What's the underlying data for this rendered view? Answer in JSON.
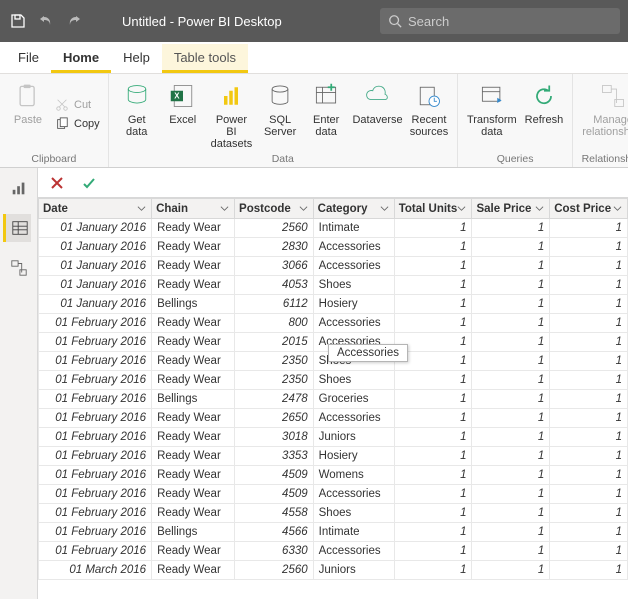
{
  "titlebar": {
    "title": "Untitled - Power BI Desktop",
    "search_placeholder": "Search"
  },
  "menutabs": {
    "file": "File",
    "home": "Home",
    "help": "Help",
    "table_tools": "Table tools"
  },
  "ribbon": {
    "group_clipboard": "Clipboard",
    "group_data": "Data",
    "group_queries": "Queries",
    "group_relationships": "Relationships",
    "paste": "Paste",
    "cut": "Cut",
    "copy": "Copy",
    "get_data": "Get\ndata",
    "excel": "Excel",
    "pbi_datasets": "Power BI\ndatasets",
    "sql_server": "SQL\nServer",
    "enter_data": "Enter\ndata",
    "dataverse": "Dataverse",
    "recent_sources": "Recent\nsources",
    "transform_data": "Transform\ndata",
    "refresh": "Refresh",
    "manage_rel": "Manage\nrelationships"
  },
  "columns": [
    "Date",
    "Chain",
    "Postcode",
    "Category",
    "Total Units",
    "Sale Price",
    "Cost Price"
  ],
  "tooltip": "Accessories",
  "rows": [
    {
      "date": "01 January 2016",
      "chain": "Ready Wear",
      "postcode": "2560",
      "category": "Intimate",
      "units": "1",
      "sale": "1",
      "cost": "1"
    },
    {
      "date": "01 January 2016",
      "chain": "Ready Wear",
      "postcode": "2830",
      "category": "Accessories",
      "units": "1",
      "sale": "1",
      "cost": "1"
    },
    {
      "date": "01 January 2016",
      "chain": "Ready Wear",
      "postcode": "3066",
      "category": "Accessories",
      "units": "1",
      "sale": "1",
      "cost": "1"
    },
    {
      "date": "01 January 2016",
      "chain": "Ready Wear",
      "postcode": "4053",
      "category": "Shoes",
      "units": "1",
      "sale": "1",
      "cost": "1"
    },
    {
      "date": "01 January 2016",
      "chain": "Bellings",
      "postcode": "6112",
      "category": "Hosiery",
      "units": "1",
      "sale": "1",
      "cost": "1"
    },
    {
      "date": "01 February 2016",
      "chain": "Ready Wear",
      "postcode": "800",
      "category": "Accessories",
      "units": "1",
      "sale": "1",
      "cost": "1"
    },
    {
      "date": "01 February 2016",
      "chain": "Ready Wear",
      "postcode": "2015",
      "category": "Accessories",
      "units": "1",
      "sale": "1",
      "cost": "1"
    },
    {
      "date": "01 February 2016",
      "chain": "Ready Wear",
      "postcode": "2350",
      "category": "Shoes",
      "units": "1",
      "sale": "1",
      "cost": "1"
    },
    {
      "date": "01 February 2016",
      "chain": "Ready Wear",
      "postcode": "2350",
      "category": "Shoes",
      "units": "1",
      "sale": "1",
      "cost": "1"
    },
    {
      "date": "01 February 2016",
      "chain": "Bellings",
      "postcode": "2478",
      "category": "Groceries",
      "units": "1",
      "sale": "1",
      "cost": "1"
    },
    {
      "date": "01 February 2016",
      "chain": "Ready Wear",
      "postcode": "2650",
      "category": "Accessories",
      "units": "1",
      "sale": "1",
      "cost": "1"
    },
    {
      "date": "01 February 2016",
      "chain": "Ready Wear",
      "postcode": "3018",
      "category": "Juniors",
      "units": "1",
      "sale": "1",
      "cost": "1"
    },
    {
      "date": "01 February 2016",
      "chain": "Ready Wear",
      "postcode": "3353",
      "category": "Hosiery",
      "units": "1",
      "sale": "1",
      "cost": "1"
    },
    {
      "date": "01 February 2016",
      "chain": "Ready Wear",
      "postcode": "4509",
      "category": "Womens",
      "units": "1",
      "sale": "1",
      "cost": "1"
    },
    {
      "date": "01 February 2016",
      "chain": "Ready Wear",
      "postcode": "4509",
      "category": "Accessories",
      "units": "1",
      "sale": "1",
      "cost": "1"
    },
    {
      "date": "01 February 2016",
      "chain": "Ready Wear",
      "postcode": "4558",
      "category": "Shoes",
      "units": "1",
      "sale": "1",
      "cost": "1"
    },
    {
      "date": "01 February 2016",
      "chain": "Bellings",
      "postcode": "4566",
      "category": "Intimate",
      "units": "1",
      "sale": "1",
      "cost": "1"
    },
    {
      "date": "01 February 2016",
      "chain": "Ready Wear",
      "postcode": "6330",
      "category": "Accessories",
      "units": "1",
      "sale": "1",
      "cost": "1"
    },
    {
      "date": "01 March 2016",
      "chain": "Ready Wear",
      "postcode": "2560",
      "category": "Juniors",
      "units": "1",
      "sale": "1",
      "cost": "1"
    }
  ]
}
